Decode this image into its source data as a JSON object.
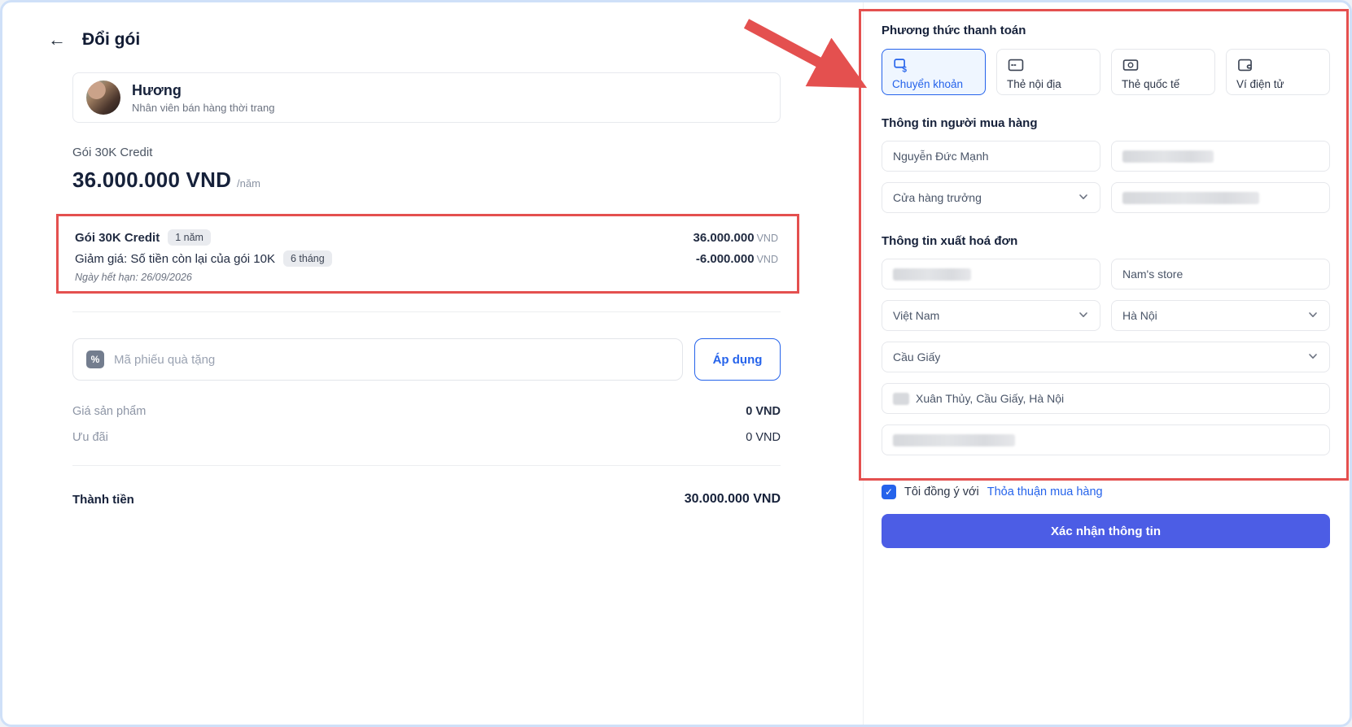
{
  "header": {
    "back_icon": "arrow-left",
    "title": "Đổi gói"
  },
  "user_card": {
    "name": "Hương",
    "role": "Nhân viên bán hàng thời trang"
  },
  "plan": {
    "name": "Gói 30K Credit",
    "price": "36.000.000 VND",
    "period": "/năm"
  },
  "order_items": {
    "items": [
      {
        "label": "Gói 30K Credit",
        "badge": "1 năm",
        "amount": "36.000.000",
        "currency": "VND"
      },
      {
        "label": "Giảm giá: Số tiền còn lại của gói 10K",
        "badge": "6 tháng",
        "amount": "-6.000.000",
        "currency": "VND"
      }
    ],
    "expiry_note": "Ngày hết hạn: 26/09/2026"
  },
  "voucher": {
    "placeholder": "Mã phiếu quà tặng",
    "apply_label": "Áp dụng",
    "icon": "coupon-icon",
    "icon_glyph": "%"
  },
  "summary": {
    "rows": [
      {
        "label": "Giá sản phẩm",
        "value": "0 VND"
      },
      {
        "label": "Ưu đãi",
        "value": "0 VND"
      }
    ],
    "total_label": "Thành tiền",
    "total_value": "30.000.000 VND"
  },
  "payment": {
    "title": "Phương thức thanh toán",
    "methods": [
      {
        "label": "Chuyển khoản",
        "icon": "bank-transfer-icon",
        "selected": true
      },
      {
        "label": "Thẻ nội địa",
        "icon": "domestic-card-icon",
        "selected": false
      },
      {
        "label": "Thẻ quốc tế",
        "icon": "international-card-icon",
        "selected": false
      },
      {
        "label": "Ví điện tử",
        "icon": "e-wallet-icon",
        "selected": false
      }
    ]
  },
  "buyer": {
    "title": "Thông tin người mua hàng",
    "name": "Nguyễn Đức Mạnh",
    "role": "Cửa hàng trưởng"
  },
  "invoice": {
    "title": "Thông tin xuất hoá đơn",
    "store": "Nam's store",
    "country": "Việt Nam",
    "city": "Hà Nội",
    "district": "Cầu Giấy",
    "address": "Xuân Thủy, Cầu Giấy, Hà Nội"
  },
  "agreement": {
    "prefix": "Tôi đồng ý với",
    "link": "Thỏa thuận mua hàng",
    "checked": true
  },
  "confirm_button": "Xác nhận thông tin",
  "colors": {
    "accent": "#2563eb",
    "button": "#4c5de5",
    "annotation": "#e4504f"
  }
}
